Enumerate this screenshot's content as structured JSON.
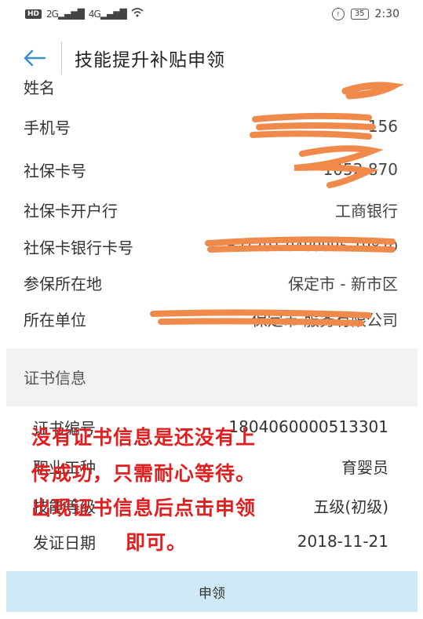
{
  "status_bar": {
    "hd": "HD",
    "sim1": "2G",
    "sim2": "4G",
    "battery": "35",
    "time": "2:30"
  },
  "header": {
    "title": "技能提升补贴申领"
  },
  "personal_info": [
    {
      "label": "姓名",
      "value": ""
    },
    {
      "label": "手机号",
      "value": "156"
    },
    {
      "label": "社保卡号",
      "value": "1052 870"
    },
    {
      "label": "社保卡开户行",
      "value": "工商银行"
    },
    {
      "label": "社保卡银行卡号",
      "value": "621791 0489995 19870"
    },
    {
      "label": "参保所在地",
      "value": "保定市 - 新市区"
    },
    {
      "label": "所在单位",
      "value": "保定市 服务有限公司"
    }
  ],
  "certificate": {
    "section_title": "证书信息",
    "rows": [
      {
        "label": "证书编号",
        "value": "1804060000513301"
      },
      {
        "label": "职业工种",
        "value": "育婴员"
      },
      {
        "label": "技能等级",
        "value": "五级(初级)"
      },
      {
        "label": "发证日期",
        "value": "2018-11-21"
      }
    ]
  },
  "annotation": {
    "line1": "没有证书信息是还没有上",
    "line2": "传成功，只需耐心等待。",
    "line3": "出现证书信息后点击申领",
    "line4": "即可。"
  },
  "apply_button": "申领",
  "colors": {
    "annotation": "#e02020",
    "scribble": "#f08a4b",
    "apply_bg": "#cfe9f7"
  }
}
